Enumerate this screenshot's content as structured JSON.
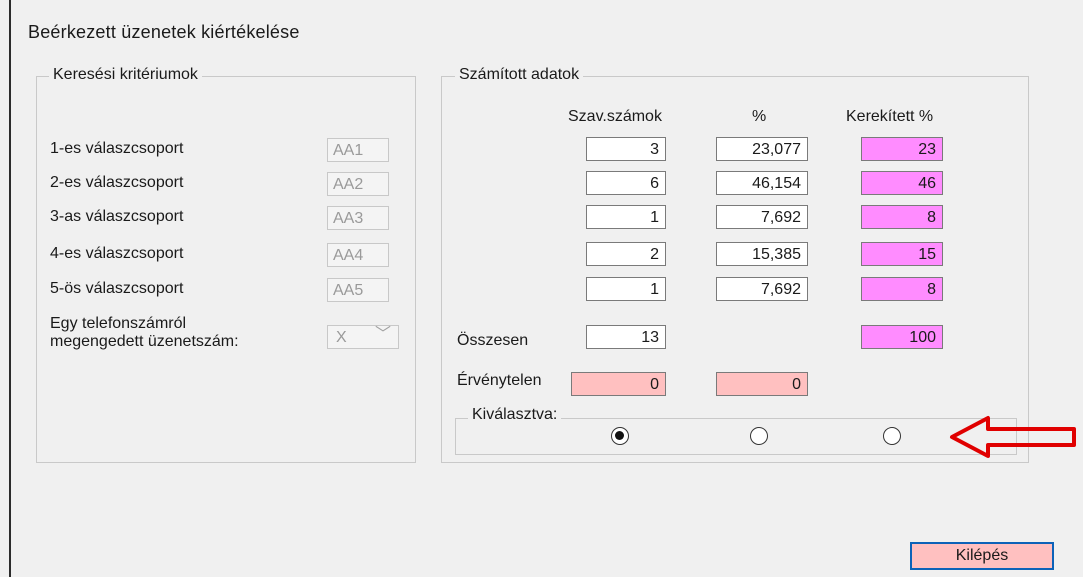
{
  "window": {
    "title": "Beérkezett üzenetek kiértékelése"
  },
  "search": {
    "legend": "Keresési kritériumok",
    "rows": [
      {
        "label": "1-es válaszcsoport",
        "value": "AA1"
      },
      {
        "label": "2-es válaszcsoport",
        "value": "AA2"
      },
      {
        "label": "3-as válaszcsoport",
        "value": "AA3"
      },
      {
        "label": "4-es válaszcsoport",
        "value": "AA4"
      },
      {
        "label": "5-ös válaszcsoport",
        "value": "AA5"
      }
    ],
    "limit_label_line1": "Egy telefonszámról",
    "limit_label_line2": "megengedett üzenetszám:",
    "limit_value": "X"
  },
  "computed": {
    "legend": "Számított adatok",
    "headers": {
      "votes": "Szav.számok",
      "percent": "%",
      "rounded": "Kerekített %"
    },
    "rows": [
      {
        "votes": "3",
        "percent": "23,077",
        "rounded": "23"
      },
      {
        "votes": "6",
        "percent": "46,154",
        "rounded": "46"
      },
      {
        "votes": "1",
        "percent": "7,692",
        "rounded": "8"
      },
      {
        "votes": "2",
        "percent": "15,385",
        "rounded": "15"
      },
      {
        "votes": "1",
        "percent": "7,692",
        "rounded": "8"
      }
    ],
    "total_label": "Összesen",
    "total_votes": "13",
    "total_rounded": "100",
    "invalid_label": "Érvénytelen",
    "invalid_votes": "0",
    "invalid_percent": "0",
    "selected_legend": "Kiválasztva:",
    "selected_option": 0
  },
  "buttons": {
    "exit": "Kilépés"
  },
  "colors": {
    "pink": "#ff8cff",
    "light_pink": "#ffc0c0",
    "arrow": "#e00000",
    "button_border": "#0d62b8"
  },
  "annotation": {
    "icon": "left-arrow-icon"
  }
}
